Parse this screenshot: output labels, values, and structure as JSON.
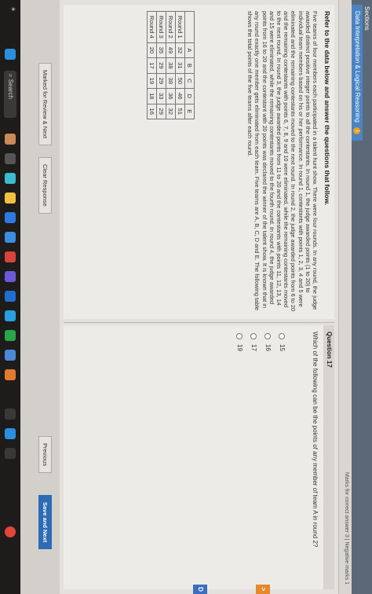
{
  "header": {
    "sections_label": "Sections",
    "section_tab": "Data Interpretation & Logical Reasoning",
    "info_icon": "i",
    "marks_text": "Marks for correct answer 3 | Negative marks 1"
  },
  "passage": {
    "title": "Refer to the data below and answer the questions that follow.",
    "text": "Five teams of four members each participated in a talent hunt show. There were four rounds. In any round, the judge awarded distinct positive integer points to all the contestants. In round 1, the judge awarded points (1 to 20) to individual team members based on his or her performance. In round 1, contestants with points 1, 2, 3, 4 and 5 were eliminated and the remaining contestants moved to the next round. In round 2, the judge awarded points from 6 to 20 and the remaining contestants with points 6, 7, 8, 9 and 10 were eliminated, while the remaining contestants moved to the next round. In round 3, the judge awarded points from 11 to 20 and the contestants with points 11, 12, 13, 14 and 15 were eliminated, while the remaining contestants moved to the fourth round. In round 4, the judge awarded points from 16 to 20 and the contestant with 20 points was declared the winner of the talent show. It is known that in any round exactly one member gets eliminated from each team. Five teams are A, B, C, D and E. The following table shows the total points of the five teams after each round.",
    "table": {
      "headers": [
        "",
        "A",
        "B",
        "C",
        "D",
        "E"
      ],
      "rows": [
        [
          "Round 1",
          "32",
          "31",
          "50",
          "46",
          "51"
        ],
        [
          "Round 2",
          "49",
          "38",
          "38",
          "36",
          "32"
        ],
        [
          "Round 3",
          "35",
          "29",
          "29",
          "33",
          "29"
        ],
        [
          "Round 4",
          "20",
          "17",
          "19",
          "18",
          "16"
        ]
      ]
    }
  },
  "question": {
    "header": "Question 17",
    "text": "Which of the following can be the points of any member of team A in round 2?",
    "options": [
      "15",
      "16",
      "17",
      "19"
    ]
  },
  "footer": {
    "mark_review": "Marked for Review & Next",
    "clear_response": "Clear Response",
    "previous": "Previous",
    "save_next": "Save and Next"
  },
  "taskbar": {
    "search_placeholder": "Search"
  },
  "colors": {
    "section_bar": "#5a6878",
    "tab_blue": "#4a84c4",
    "primary_button": "#2d6cb5"
  }
}
